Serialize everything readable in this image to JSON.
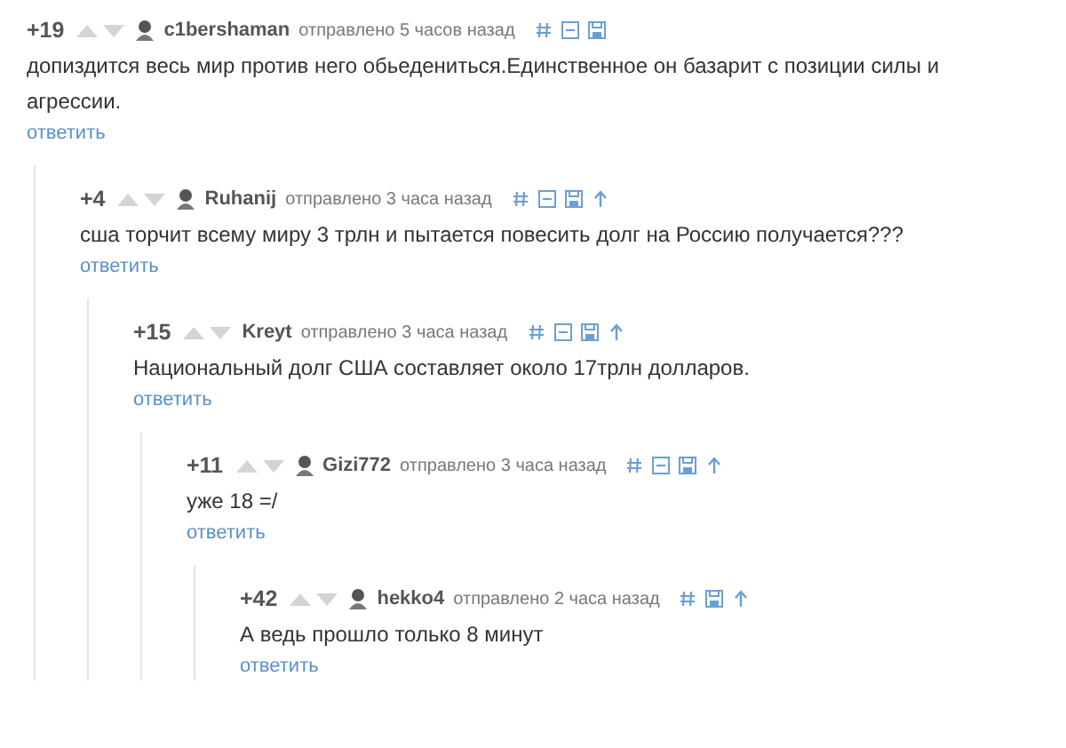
{
  "comments": [
    {
      "score": "+19",
      "avatar": true,
      "author": "c1bershaman",
      "meta": "отправлено 5 часов назад",
      "tools": [
        {
          "kind": "hash"
        },
        {
          "kind": "collapse"
        },
        {
          "kind": "save"
        }
      ],
      "text": "допиздится весь мир против него обьедениться.Единственное он базарит с позиции силы и агрессии.",
      "reply": "ответить",
      "children": [
        {
          "score": "+4",
          "avatar": true,
          "author": "Ruhanij",
          "meta": "отправлено 3 часа назад",
          "tools": [
            {
              "kind": "hash"
            },
            {
              "kind": "collapse"
            },
            {
              "kind": "save"
            },
            {
              "kind": "parent"
            }
          ],
          "text": "сша торчит всему миру 3 трлн и пытается повесить долг на Россию получается???",
          "reply": "ответить",
          "children": [
            {
              "score": "+15",
              "avatar": false,
              "author": "Kreyt",
              "meta": "отправлено 3 часа назад",
              "tools": [
                {
                  "kind": "hash"
                },
                {
                  "kind": "collapse"
                },
                {
                  "kind": "save"
                },
                {
                  "kind": "parent"
                }
              ],
              "text": "Национальный долг США составляет около 17трлн долларов.",
              "reply": "ответить",
              "children": [
                {
                  "score": "+11",
                  "avatar": true,
                  "author": "Gizi772",
                  "meta": "отправлено 3 часа назад",
                  "tools": [
                    {
                      "kind": "hash"
                    },
                    {
                      "kind": "collapse"
                    },
                    {
                      "kind": "save"
                    },
                    {
                      "kind": "parent"
                    }
                  ],
                  "text": "уже 18 =/",
                  "reply": "ответить",
                  "children": [
                    {
                      "score": "+42",
                      "avatar": true,
                      "author": "hekko4",
                      "meta": "отправлено 2 часа назад",
                      "tools": [
                        {
                          "kind": "hash"
                        },
                        {
                          "kind": "save"
                        },
                        {
                          "kind": "parent"
                        }
                      ],
                      "text": "А ведь прошло только 8 минут",
                      "reply": "ответить"
                    }
                  ]
                }
              ]
            }
          ]
        }
      ]
    }
  ]
}
